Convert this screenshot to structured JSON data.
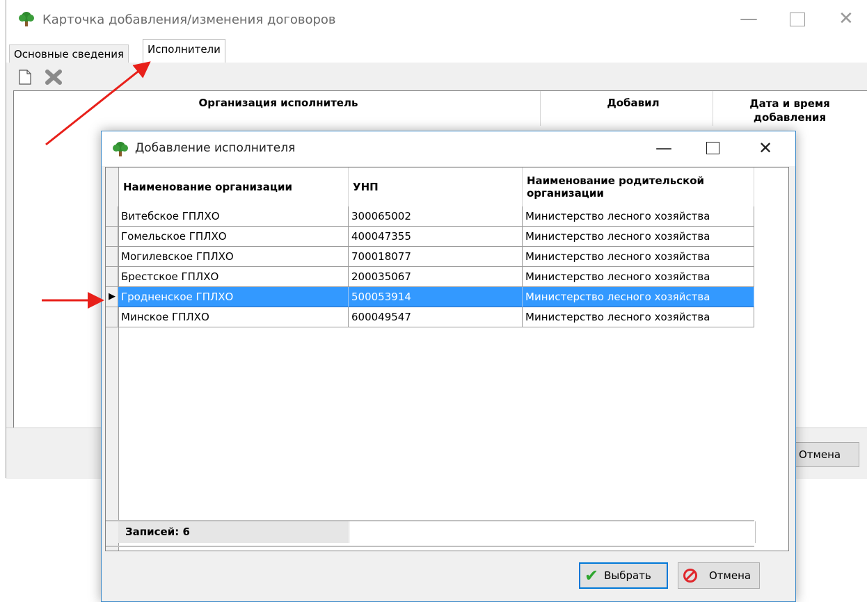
{
  "main_window": {
    "title": "Карточка добавления/изменения договоров",
    "tabs": [
      {
        "label": "Основные сведения",
        "active": false
      },
      {
        "label": "Исполнители",
        "active": true
      }
    ],
    "toolbar": {
      "add_icon": "new-document-icon",
      "delete_icon": "delete-x-icon"
    },
    "columns": [
      "Организация исполнитель",
      "Добавил",
      "Дата и время добавления"
    ],
    "cancel_label": "Отмена"
  },
  "dialog": {
    "title": "Добавление исполнителя",
    "columns": [
      "Наименование организации",
      "УНП",
      "Наименование родительской организации"
    ],
    "rows": [
      {
        "name": "Витебское ГПЛХО",
        "unp": "300065002",
        "parent": "Министерство лесного хозяйства"
      },
      {
        "name": "Гомельское ГПЛХО",
        "unp": "400047355",
        "parent": "Министерство лесного хозяйства"
      },
      {
        "name": "Могилевское ГПЛХО",
        "unp": "700018077",
        "parent": "Министерство лесного хозяйства"
      },
      {
        "name": "Брестское ГПЛХО",
        "unp": "200035067",
        "parent": "Министерство лесного хозяйства"
      },
      {
        "name": "Гродненское ГПЛХО",
        "unp": "500053914",
        "parent": "Министерство лесного хозяйства"
      },
      {
        "name": "Минское ГПЛХО",
        "unp": "600049547",
        "parent": "Министерство лесного хозяйства"
      }
    ],
    "selected_row_index": 4,
    "records_label": "Записей: 6",
    "select_label": "Выбрать",
    "cancel_label": "Отмена"
  },
  "colors": {
    "selection": "#3399ff",
    "annotation_arrow": "#e8201a",
    "dialog_border": "#3c8ac9",
    "tree_icon_foliage": "#2e8b2e"
  }
}
